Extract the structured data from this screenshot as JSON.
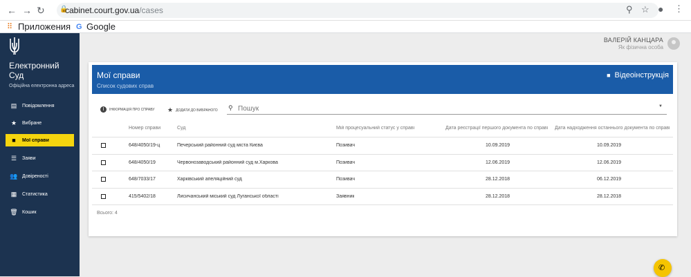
{
  "browser": {
    "url_host": "cabinet.court.gov.ua",
    "url_path": "/cases",
    "bookmarks": [
      "Приложения",
      "Google"
    ]
  },
  "sidebar": {
    "brand_line1": "Електронний",
    "brand_line2": "Суд",
    "brand_sub": "Офіційна електронна адреса",
    "items": [
      {
        "label": "Повідомлення",
        "icon": "message-icon"
      },
      {
        "label": "Вибране",
        "icon": "star-icon"
      },
      {
        "label": "Мої справи",
        "icon": "folder-icon",
        "active": true
      },
      {
        "label": "Заяви",
        "icon": "list-icon"
      },
      {
        "label": "Довіреності",
        "icon": "people-icon"
      },
      {
        "label": "Статистика",
        "icon": "chart-icon"
      },
      {
        "label": "Кошик",
        "icon": "trash-icon"
      }
    ]
  },
  "user": {
    "name": "ВАЛЕРІЙ КАНЦАРА",
    "role": "Як фізична особа"
  },
  "card": {
    "title": "Мої справи",
    "subtitle": "Список судових справ",
    "video_label": "Відеоінструкція"
  },
  "toolbar": {
    "info_label": "Інформація про справу",
    "fav_label": "Додати до вибраного",
    "search_placeholder": "Пошук"
  },
  "table": {
    "headers": [
      "Номер справи",
      "Суд",
      "Мій процесуальний статус у справі",
      "Дата реєстрації першого документа по справі",
      "Дата надходження останнього документа по справі"
    ],
    "rows": [
      {
        "number": "648/4050/19-ц",
        "court": "Печерський районний суд міста Києва",
        "status": "Позивач",
        "first_date": "10.09.2019",
        "last_date": "10.09.2019"
      },
      {
        "number": "648/4050/19",
        "court": "Червонозаводський районний суд м.Харкова",
        "status": "Позивач",
        "first_date": "12.06.2019",
        "last_date": "12.06.2019"
      },
      {
        "number": "648/7033/17",
        "court": "Харківський апеляційний суд",
        "status": "Позивач",
        "first_date": "28.12.2018",
        "last_date": "06.12.2019"
      },
      {
        "number": "415/5402/18",
        "court": "Лисичанський міський суд Луганської області",
        "status": "Заявник",
        "first_date": "28.12.2018",
        "last_date": "28.12.2018"
      }
    ],
    "total": "Всього: 4"
  },
  "colors": {
    "sidebar_bg": "#1c3350",
    "header_blue": "#1a5ca8",
    "active_yellow": "#f5d50e"
  }
}
